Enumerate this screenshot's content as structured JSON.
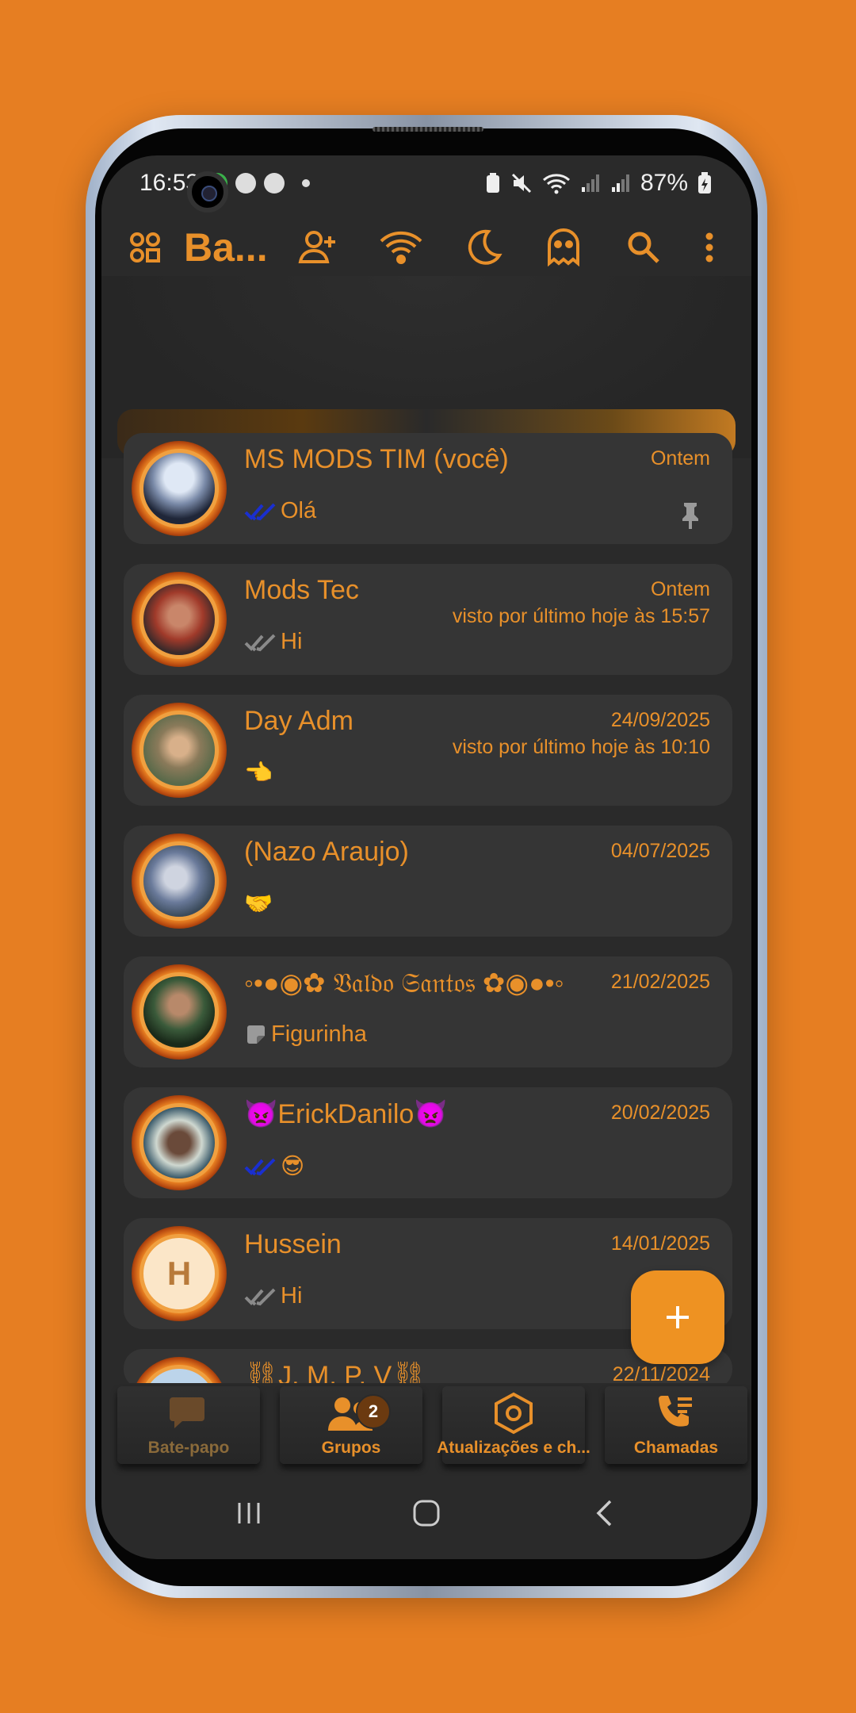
{
  "colors": {
    "accent": "#E8902A",
    "background": "#E67E22",
    "card": "#353535",
    "screen": "#2a2a2a"
  },
  "status_bar": {
    "time": "16:53",
    "battery": "87%"
  },
  "toolbar": {
    "title": "Ba...",
    "icons": [
      "apps-icon",
      "add-contact-icon",
      "wifi-icon",
      "moon-icon",
      "ghost-icon",
      "search-icon",
      "more-vert-icon"
    ]
  },
  "chats": [
    {
      "name": "MS MODS TIM (você)",
      "time": "Ontem",
      "seen": "",
      "message": "Olá",
      "tick": "read",
      "pinned": true,
      "avatar": "avatar-anime"
    },
    {
      "name": "Mods Tec",
      "time": "Ontem",
      "seen": "visto por último hoje às 15:57",
      "message": "Hi",
      "tick": "delivered",
      "pinned": false,
      "avatar": "avatar-photo"
    },
    {
      "name": "Day Adm",
      "time": "24/09/2025",
      "seen": "visto por último hoje às 10:10",
      "message": "👈",
      "tick": "",
      "pinned": false,
      "avatar": "avatar-photo"
    },
    {
      "name": "(Nazo Araujo)",
      "time": "04/07/2025",
      "seen": "",
      "message": "🤝",
      "tick": "",
      "pinned": false,
      "avatar": "avatar-photo"
    },
    {
      "name": "◦•●◉✿ 𝔙𝔞𝔩𝔡𝔬 𝔖𝔞𝔫𝔱𝔬𝔰 ✿◉●•◦",
      "time": "21/02/2025",
      "seen": "",
      "message": "Figurinha",
      "tick": "sticker",
      "pinned": false,
      "avatar": "avatar-photo"
    },
    {
      "name": "👿ErickDanilo👿",
      "time": "20/02/2025",
      "seen": "",
      "message": "😎",
      "tick": "read",
      "pinned": false,
      "avatar": "avatar-photo"
    },
    {
      "name": "Hussein",
      "time": "14/01/2025",
      "seen": "",
      "message": "Hi",
      "tick": "delivered",
      "pinned": false,
      "avatar": "avatar-letter-H"
    },
    {
      "name": "⛓J. M. P. V⛓",
      "time": "22/11/2024",
      "seen": "",
      "message": "",
      "tick": "",
      "pinned": false,
      "avatar": "avatar-photo"
    }
  ],
  "avatar_letter": "H",
  "fab": {
    "icon": "plus-icon"
  },
  "bottom_nav": {
    "tabs": [
      {
        "label": "Bate-papo",
        "icon": "chat-icon"
      },
      {
        "label": "Grupos",
        "icon": "groups-icon",
        "badge": "2"
      },
      {
        "label": "Atualizações e ch...",
        "icon": "updates-icon"
      },
      {
        "label": "Chamadas",
        "icon": "calls-icon"
      }
    ]
  }
}
